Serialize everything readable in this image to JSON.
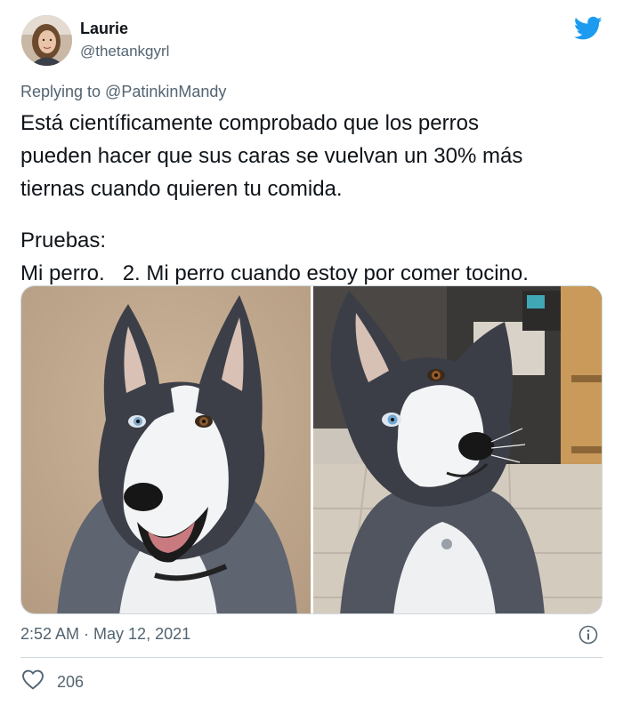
{
  "user": {
    "name": "Laurie",
    "handle": "@thetankgyrl"
  },
  "tweet": {
    "replying_to": "Replying to @PatinkinMandy",
    "lines": [
      "Está científicamente comprobado que los perros",
      "pueden hacer que sus caras se vuelvan un 30% más",
      "tiernas cuando quieren tu comida."
    ],
    "lines2": [
      "Pruebas:",
      "Mi perro.   2. Mi perro cuando estoy por comer tocino."
    ],
    "timestamp": "2:52 AM · May 12, 2021",
    "likes": "206"
  },
  "colors": {
    "brand": "#1d9bf0",
    "text": "#0f1419",
    "secondary": "#536471",
    "border": "#cfd9de"
  },
  "icons": {
    "logo": "twitter-bird-icon",
    "info": "info-icon",
    "like": "heart-icon"
  }
}
